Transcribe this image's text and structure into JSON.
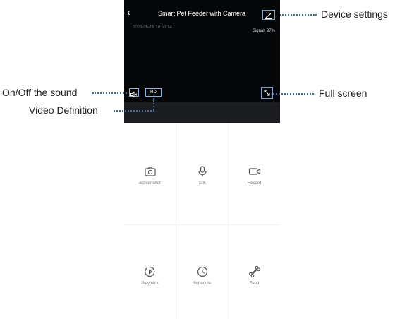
{
  "header": {
    "back_glyph": "‹",
    "title": "Smart Pet Feeder with Camera"
  },
  "video": {
    "timestamp": "2023-05-16 10:50:14",
    "signal": "Signal: 97%",
    "quality_label": "HD"
  },
  "actions": [
    {
      "label": "Screenshot",
      "icon": "camera-icon"
    },
    {
      "label": "Talk",
      "icon": "microphone-icon"
    },
    {
      "label": "Record",
      "icon": "video-record-icon"
    },
    {
      "label": "Playback",
      "icon": "playback-icon"
    },
    {
      "label": "Schedule",
      "icon": "clock-icon"
    },
    {
      "label": "Feed",
      "icon": "bone-icon"
    }
  ],
  "annotations": {
    "device_settings": "Device settings",
    "sound": "On/Off the sound",
    "definition": "Video Definition",
    "full_screen": "Full screen"
  },
  "colors": {
    "video_bg": "#050608",
    "highlight_box": "#8db2dd",
    "annotation_dots": "#3f6a9c",
    "label_gray": "#727272"
  }
}
